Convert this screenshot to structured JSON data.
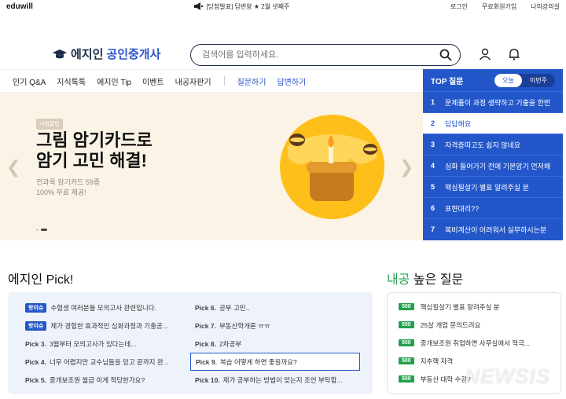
{
  "topbar": {
    "logo": "eduwill",
    "notice_label": "[당첨발표] 답변왕 ★ 2월 넷째주",
    "links": [
      "로그인",
      "무료회원가입",
      "나의강의실"
    ]
  },
  "brand": {
    "name_dark": "에지인",
    "name_blue": "공인중개사"
  },
  "search": {
    "placeholder": "검색어를 입력하세요."
  },
  "nav": {
    "items": [
      "인기 Q&A",
      "지식톡톡",
      "에지인 Tip",
      "이벤트",
      "내공자판기"
    ],
    "blue_items": [
      "질문하기",
      "답변하기"
    ]
  },
  "banner": {
    "tag": "시험꿀팁",
    "title_line1": "그림 암기카드로",
    "title_line2": "암기 고민 해결!",
    "sub_line1": "전과목 암기카드 59종",
    "sub_line2": "100% 무료 제공!"
  },
  "top_questions": {
    "title": "TOP 질문",
    "toggle": [
      "오늘",
      "이번주"
    ],
    "items": [
      {
        "n": "1",
        "text": "문제풀이 과정 생략하고 기출을 한번"
      },
      {
        "n": "2",
        "text": "답답해요"
      },
      {
        "n": "3",
        "text": "자격증따고도 쉽지 않네요"
      },
      {
        "n": "4",
        "text": "심화 들어가기 전에 기본암기 먼저해"
      },
      {
        "n": "5",
        "text": "핵심필살기 별표 알려주실 분"
      },
      {
        "n": "6",
        "text": "표현대리??"
      },
      {
        "n": "7",
        "text": "복비계산이 어려워서 실무하시는분"
      }
    ]
  },
  "pick": {
    "title": "에지인 Pick!",
    "left": [
      {
        "badge": "핫이슈",
        "label": "",
        "text": "수험생 여러분들 모의고사 관련입니다."
      },
      {
        "badge": "핫이슈",
        "label": "",
        "text": "제가 경험한 효과적인 심화과정과 기출공..."
      },
      {
        "badge": "",
        "label": "Pick 3.",
        "text": "3월부터 모의고사가 있다는데..."
      },
      {
        "badge": "",
        "label": "Pick 4.",
        "text": "너무 어렵지만 교수님들을 믿고 끝까지 완..."
      },
      {
        "badge": "",
        "label": "Pick 5.",
        "text": "중개보조원 월급 이게 적당한가요?"
      }
    ],
    "right": [
      {
        "label": "Pick 6.",
        "text": "공부 고민.."
      },
      {
        "label": "Pick 7.",
        "text": "부동산학개론 ㅠㅠ"
      },
      {
        "label": "Pick 8.",
        "text": "2차공부"
      },
      {
        "label": "Pick 9.",
        "text": "복습 어떻게 하면 좋을까요?"
      },
      {
        "label": "Pick 10.",
        "text": "제가 공부하는 방법이 맞는지 조언 부탁함..."
      }
    ]
  },
  "naegong": {
    "title_green": "내공",
    "title_rest": " 높은 질문",
    "items": [
      {
        "pts": "500",
        "text": "핵심필살기 별표 알려주실 분"
      },
      {
        "pts": "500",
        "text": "25살 개업 문의드려요"
      },
      {
        "pts": "500",
        "text": "중개보조원 취업하면 사무실에서 적극..."
      },
      {
        "pts": "500",
        "text": "지추핵 자격"
      },
      {
        "pts": "500",
        "text": "부동산 대학 수강?"
      }
    ]
  },
  "watermark": "NEWSIS"
}
